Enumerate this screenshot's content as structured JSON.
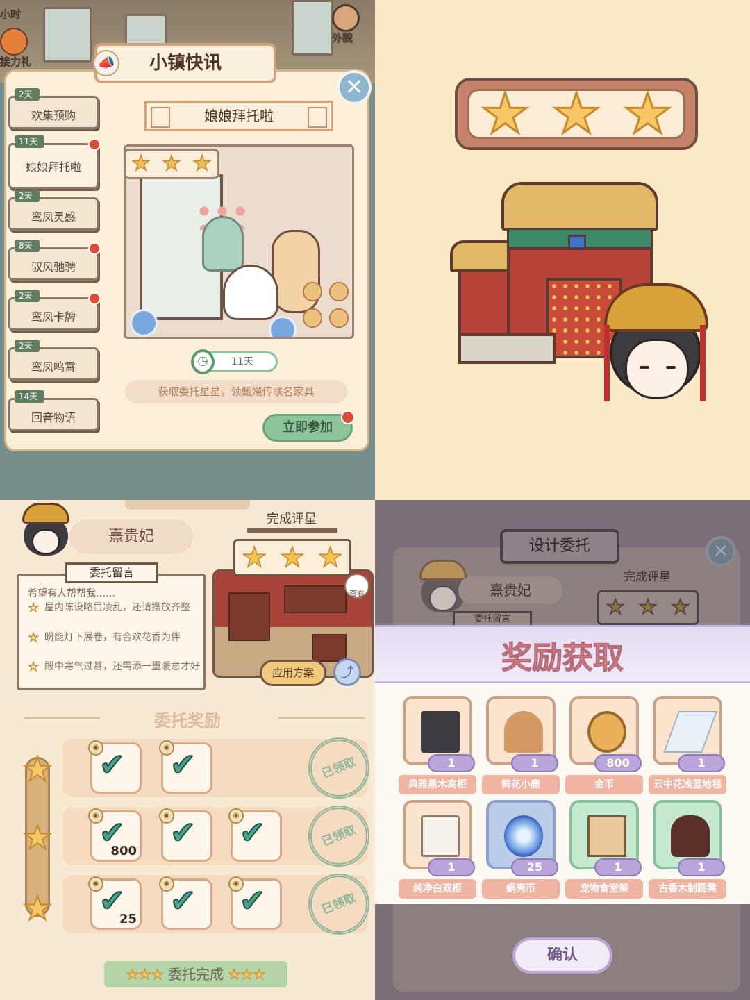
{
  "q1": {
    "corner_top": "小时",
    "corner_gift": "接力礼",
    "appearance": "外貌",
    "panel_title": "小镇快讯",
    "sidebar": [
      {
        "days": "2天",
        "label": "欢集预购",
        "dot": false
      },
      {
        "days": "11天",
        "label": "娘娘拜托啦",
        "dot": true
      },
      {
        "days": "2天",
        "label": "鸾凤灵感",
        "dot": false
      },
      {
        "days": "8天",
        "label": "驭风驰骋",
        "dot": true
      },
      {
        "days": "2天",
        "label": "鸾凤卡牌",
        "dot": true
      },
      {
        "days": "2天",
        "label": "鸾凤鸣霄",
        "dot": false
      },
      {
        "days": "14天",
        "label": "回音物语",
        "dot": false
      }
    ],
    "event_title": "娘娘拜托啦",
    "timer": "11天",
    "description": "获取委托星星，领甄嬛传联名家具",
    "join_button": "立即参加"
  },
  "q3": {
    "name": "熹贵妃",
    "message_tag": "委托留言",
    "message_intro": "希望有人帮帮我……",
    "message_lines": [
      "屋内陈设略显凌乱，还请摆放齐整",
      "盼能灯下展卷，有合欢花香为伴",
      "殿中寒气过甚，还需添一重暖意才好"
    ],
    "rating_title": "完成评星",
    "view_label": "查看",
    "apply_button": "应用方案",
    "reward_title": "委托奖励",
    "rows": [
      {
        "items": [
          {
            "amount": ""
          },
          {
            "amount": ""
          }
        ],
        "stamp": "已领取"
      },
      {
        "items": [
          {
            "amount": "800"
          },
          {
            "amount": ""
          },
          {
            "amount": ""
          }
        ],
        "stamp": "已领取"
      },
      {
        "items": [
          {
            "amount": "25"
          },
          {
            "amount": ""
          },
          {
            "amount": ""
          }
        ],
        "stamp": "已领取"
      }
    ],
    "complete": "委托完成"
  },
  "q4": {
    "title": "设计委托",
    "name": "熹贵妃",
    "rating_title": "完成评星",
    "message_tag": "委托留言",
    "modal_title": "奖励获取",
    "rewards": [
      {
        "count": "1",
        "name": "典雅黑木高柜"
      },
      {
        "count": "1",
        "name": "鲜花小鹿"
      },
      {
        "count": "800",
        "name": "金币"
      },
      {
        "count": "1",
        "name": "云中花浅蓝地毯"
      },
      {
        "count": "1",
        "name": "纯净白双柜"
      },
      {
        "count": "25",
        "name": "蜗壳币"
      },
      {
        "count": "1",
        "name": "宠物食堂架"
      },
      {
        "count": "1",
        "name": "古香木制圆凳"
      }
    ],
    "confirm_button": "确认"
  },
  "icons": {
    "star": "★",
    "check": "✔",
    "close": "✕",
    "share": "share-icon",
    "megaphone": "megaphone-icon",
    "clock": "clock-icon"
  },
  "colors": {
    "panel_bg": "#fbefd8",
    "accent_green": "#8fc49a",
    "star_gold": "#f5c765",
    "notice_red": "#d94b3a",
    "modal_pink": "#d88a93"
  }
}
